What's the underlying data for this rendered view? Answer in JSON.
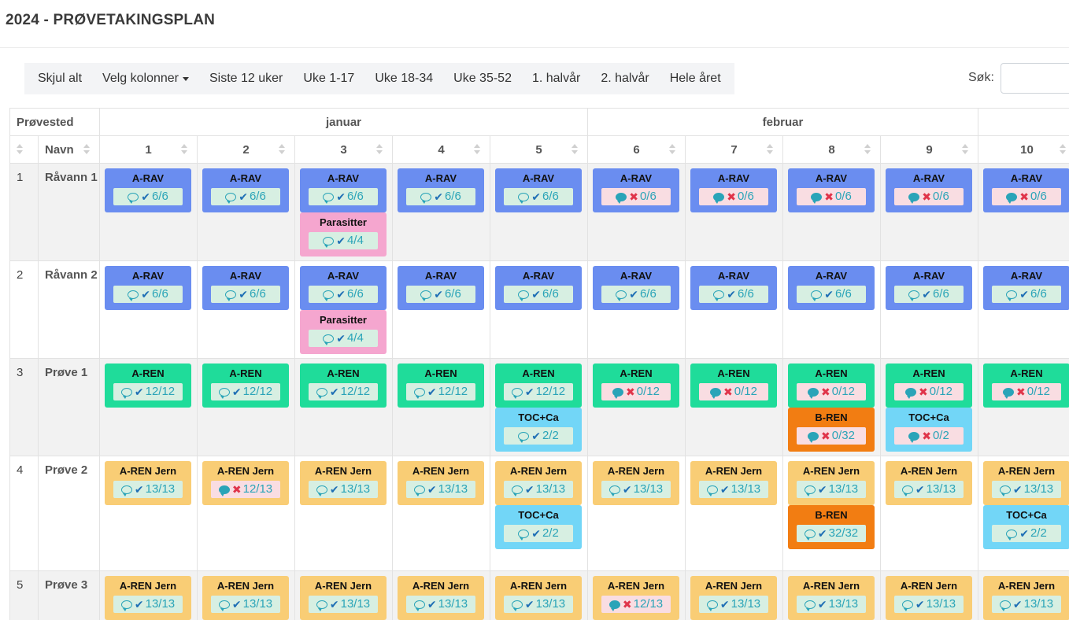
{
  "header": {
    "title": "2024 - PRØVETAKINGSPLAN"
  },
  "toolbar": {
    "buttons": [
      "Skjul alt",
      "Velg kolonner",
      "Siste 12 uker",
      "Uke 1-17",
      "Uke 18-34",
      "Uke 35-52",
      "1. halvår",
      "2. halvår",
      "Hele året"
    ],
    "dropdown_index": 1
  },
  "search": {
    "label": "Søk:",
    "value": ""
  },
  "table": {
    "group_header": "Prøvested",
    "months": [
      {
        "label": "januar",
        "span": 5
      },
      {
        "label": "februar",
        "span": 4
      },
      {
        "label": "",
        "span": 2
      }
    ],
    "col_num": "",
    "col_name": "Navn",
    "weeks": [
      "1",
      "2",
      "3",
      "4",
      "5",
      "6",
      "7",
      "8",
      "9",
      "10"
    ],
    "rows": [
      {
        "num": "1",
        "name": "Råvann 1",
        "cells": [
          [
            {
              "t": "A-RAV",
              "c": "#6a8df0",
              "s": "ok",
              "v": "6/6"
            }
          ],
          [
            {
              "t": "A-RAV",
              "c": "#6a8df0",
              "s": "ok",
              "v": "6/6"
            }
          ],
          [
            {
              "t": "A-RAV",
              "c": "#6a8df0",
              "s": "ok",
              "v": "6/6"
            },
            {
              "t": "Parasitter",
              "c": "#f5a6cf",
              "s": "ok",
              "v": "4/4"
            }
          ],
          [
            {
              "t": "A-RAV",
              "c": "#6a8df0",
              "s": "ok",
              "v": "6/6"
            }
          ],
          [
            {
              "t": "A-RAV",
              "c": "#6a8df0",
              "s": "ok",
              "v": "6/6"
            }
          ],
          [
            {
              "t": "A-RAV",
              "c": "#6a8df0",
              "s": "bad",
              "v": "0/6"
            }
          ],
          [
            {
              "t": "A-RAV",
              "c": "#6a8df0",
              "s": "bad",
              "v": "0/6"
            }
          ],
          [
            {
              "t": "A-RAV",
              "c": "#6a8df0",
              "s": "bad",
              "v": "0/6"
            }
          ],
          [
            {
              "t": "A-RAV",
              "c": "#6a8df0",
              "s": "bad",
              "v": "0/6"
            }
          ],
          [
            {
              "t": "A-RAV",
              "c": "#6a8df0",
              "s": "bad",
              "v": "0/6"
            }
          ]
        ]
      },
      {
        "num": "2",
        "name": "Råvann 2",
        "cells": [
          [
            {
              "t": "A-RAV",
              "c": "#6a8df0",
              "s": "ok",
              "v": "6/6"
            }
          ],
          [
            {
              "t": "A-RAV",
              "c": "#6a8df0",
              "s": "ok",
              "v": "6/6"
            }
          ],
          [
            {
              "t": "A-RAV",
              "c": "#6a8df0",
              "s": "ok",
              "v": "6/6"
            },
            {
              "t": "Parasitter",
              "c": "#f5a6cf",
              "s": "ok",
              "v": "4/4"
            }
          ],
          [
            {
              "t": "A-RAV",
              "c": "#6a8df0",
              "s": "ok",
              "v": "6/6"
            }
          ],
          [
            {
              "t": "A-RAV",
              "c": "#6a8df0",
              "s": "ok",
              "v": "6/6"
            }
          ],
          [
            {
              "t": "A-RAV",
              "c": "#6a8df0",
              "s": "ok",
              "v": "6/6"
            }
          ],
          [
            {
              "t": "A-RAV",
              "c": "#6a8df0",
              "s": "ok",
              "v": "6/6"
            }
          ],
          [
            {
              "t": "A-RAV",
              "c": "#6a8df0",
              "s": "ok",
              "v": "6/6"
            }
          ],
          [
            {
              "t": "A-RAV",
              "c": "#6a8df0",
              "s": "ok",
              "v": "6/6"
            }
          ],
          [
            {
              "t": "A-RAV",
              "c": "#6a8df0",
              "s": "ok",
              "v": "6/6"
            }
          ]
        ]
      },
      {
        "num": "3",
        "name": "Prøve 1",
        "cells": [
          [
            {
              "t": "A-REN",
              "c": "#1fdc9a",
              "s": "ok",
              "v": "12/12"
            }
          ],
          [
            {
              "t": "A-REN",
              "c": "#1fdc9a",
              "s": "ok",
              "v": "12/12"
            }
          ],
          [
            {
              "t": "A-REN",
              "c": "#1fdc9a",
              "s": "ok",
              "v": "12/12"
            }
          ],
          [
            {
              "t": "A-REN",
              "c": "#1fdc9a",
              "s": "ok",
              "v": "12/12"
            }
          ],
          [
            {
              "t": "A-REN",
              "c": "#1fdc9a",
              "s": "ok",
              "v": "12/12"
            },
            {
              "t": "TOC+Ca",
              "c": "#72d6f7",
              "s": "ok",
              "v": "2/2"
            }
          ],
          [
            {
              "t": "A-REN",
              "c": "#1fdc9a",
              "s": "bad",
              "v": "0/12"
            }
          ],
          [
            {
              "t": "A-REN",
              "c": "#1fdc9a",
              "s": "bad",
              "v": "0/12"
            }
          ],
          [
            {
              "t": "A-REN",
              "c": "#1fdc9a",
              "s": "bad",
              "v": "0/12"
            },
            {
              "t": "B-REN",
              "c": "#f27d12",
              "s": "bad",
              "v": "0/32"
            }
          ],
          [
            {
              "t": "A-REN",
              "c": "#1fdc9a",
              "s": "bad",
              "v": "0/12"
            },
            {
              "t": "TOC+Ca",
              "c": "#72d6f7",
              "s": "bad",
              "v": "0/2"
            }
          ],
          [
            {
              "t": "A-REN",
              "c": "#1fdc9a",
              "s": "bad",
              "v": "0/12"
            }
          ]
        ]
      },
      {
        "num": "4",
        "name": "Prøve 2",
        "cells": [
          [
            {
              "t": "A-REN Jern",
              "c": "#f9cd75",
              "s": "ok",
              "v": "13/13"
            }
          ],
          [
            {
              "t": "A-REN Jern",
              "c": "#f9cd75",
              "s": "bad",
              "v": "12/13"
            }
          ],
          [
            {
              "t": "A-REN Jern",
              "c": "#f9cd75",
              "s": "ok",
              "v": "13/13"
            }
          ],
          [
            {
              "t": "A-REN Jern",
              "c": "#f9cd75",
              "s": "ok",
              "v": "13/13"
            }
          ],
          [
            {
              "t": "A-REN Jern",
              "c": "#f9cd75",
              "s": "ok",
              "v": "13/13"
            },
            {
              "t": "TOC+Ca",
              "c": "#72d6f7",
              "s": "ok",
              "v": "2/2"
            }
          ],
          [
            {
              "t": "A-REN Jern",
              "c": "#f9cd75",
              "s": "ok",
              "v": "13/13"
            }
          ],
          [
            {
              "t": "A-REN Jern",
              "c": "#f9cd75",
              "s": "ok",
              "v": "13/13"
            }
          ],
          [
            {
              "t": "A-REN Jern",
              "c": "#f9cd75",
              "s": "ok",
              "v": "13/13"
            },
            {
              "t": "B-REN",
              "c": "#f27d12",
              "s": "ok",
              "v": "32/32"
            }
          ],
          [
            {
              "t": "A-REN Jern",
              "c": "#f9cd75",
              "s": "ok",
              "v": "13/13"
            }
          ],
          [
            {
              "t": "A-REN Jern",
              "c": "#f9cd75",
              "s": "ok",
              "v": "13/13"
            },
            {
              "t": "TOC+Ca",
              "c": "#72d6f7",
              "s": "ok",
              "v": "2/2"
            }
          ]
        ]
      },
      {
        "num": "5",
        "name": "Prøve 3",
        "cells": [
          [
            {
              "t": "A-REN Jern",
              "c": "#f9cd75",
              "s": "ok",
              "v": "13/13"
            }
          ],
          [
            {
              "t": "A-REN Jern",
              "c": "#f9cd75",
              "s": "ok",
              "v": "13/13"
            }
          ],
          [
            {
              "t": "A-REN Jern",
              "c": "#f9cd75",
              "s": "ok",
              "v": "13/13"
            }
          ],
          [
            {
              "t": "A-REN Jern",
              "c": "#f9cd75",
              "s": "ok",
              "v": "13/13"
            }
          ],
          [
            {
              "t": "A-REN Jern",
              "c": "#f9cd75",
              "s": "ok",
              "v": "13/13"
            }
          ],
          [
            {
              "t": "A-REN Jern",
              "c": "#f9cd75",
              "s": "bad",
              "v": "12/13"
            }
          ],
          [
            {
              "t": "A-REN Jern",
              "c": "#f9cd75",
              "s": "ok",
              "v": "13/13"
            }
          ],
          [
            {
              "t": "A-REN Jern",
              "c": "#f9cd75",
              "s": "ok",
              "v": "13/13"
            }
          ],
          [
            {
              "t": "A-REN Jern",
              "c": "#f9cd75",
              "s": "ok",
              "v": "13/13"
            }
          ],
          [
            {
              "t": "A-REN Jern",
              "c": "#f9cd75",
              "s": "ok",
              "v": "13/13"
            }
          ]
        ]
      }
    ],
    "icons": {
      "comment": "comment-icon",
      "check": "check-icon",
      "cross": "cross-icon"
    }
  }
}
